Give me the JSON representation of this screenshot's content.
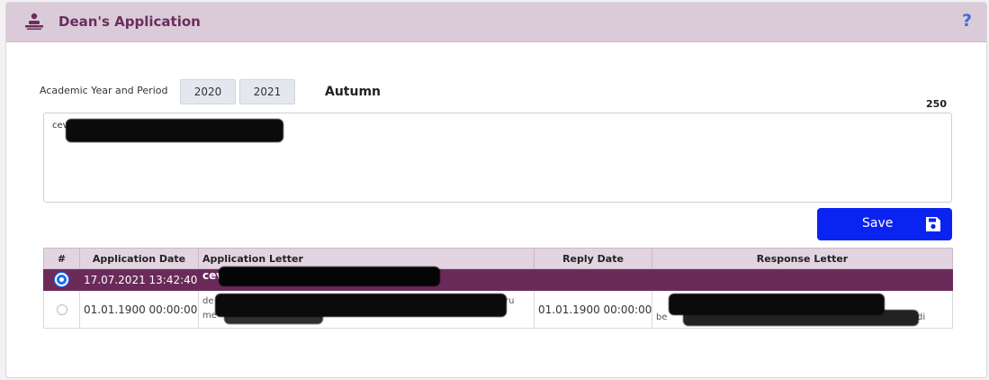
{
  "header": {
    "title": "Dean's Application",
    "help_label": "?",
    "icon": "person-desk-icon"
  },
  "period": {
    "label": "Academic Year and Period",
    "year_start": "2020",
    "year_end": "2021",
    "term": "Autumn"
  },
  "letter": {
    "char_count": "250",
    "visible_prefix": "cev"
  },
  "save_button": {
    "label": "Save",
    "icon": "floppy-disk-icon"
  },
  "table": {
    "columns": [
      "#",
      "Application Date",
      "Application Letter",
      "Reply Date",
      "Response Letter"
    ],
    "rows": [
      {
        "selected": true,
        "application_date": "17.07.2021 13:42:40",
        "application_letter": "cev",
        "reply_date": "",
        "response_letter": ""
      },
      {
        "selected": false,
        "application_date": "01.01.1900 00:00:00",
        "application_letter_line1": "de",
        "application_letter_line1_end": "ru",
        "application_letter_line2": "me",
        "reply_date": "01.01.1900 00:00:00",
        "response_letter_start": "be",
        "response_letter_end": "di"
      }
    ]
  },
  "colors": {
    "header_bg": "#dbcbd8",
    "title": "#6b2d5c",
    "selected_row": "#6a2b5a",
    "save_button": "#0a23f0",
    "help_icon": "#3a6fd6"
  }
}
